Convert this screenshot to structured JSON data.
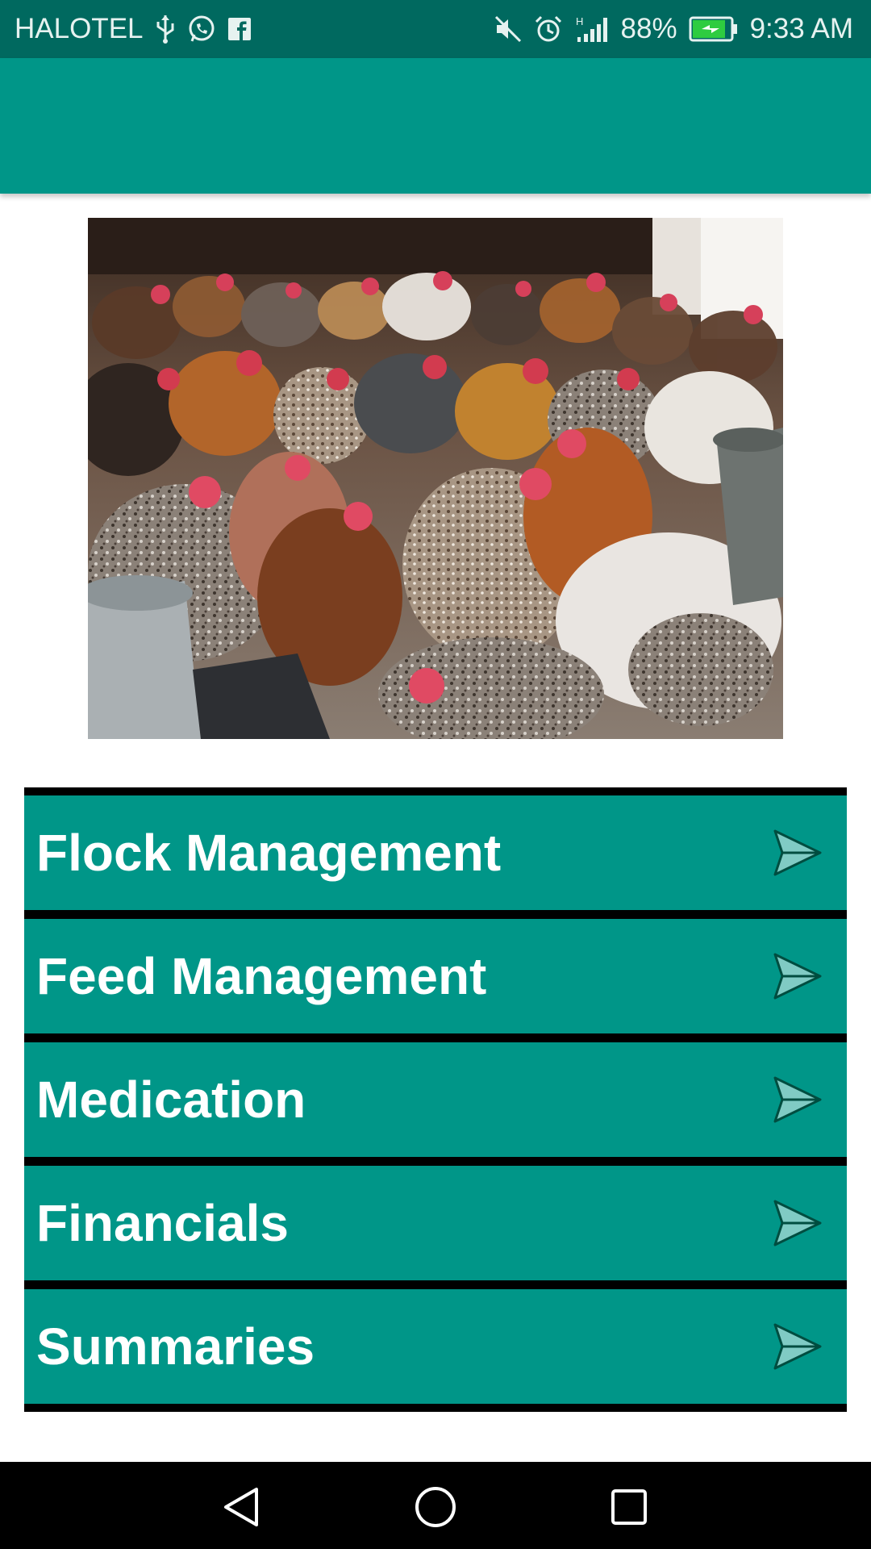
{
  "status_bar": {
    "carrier": "HALOTEL",
    "left_icons": [
      "usb-icon",
      "whatsapp-icon",
      "facebook-icon"
    ],
    "right_icons": [
      "mute-icon",
      "alarm-icon",
      "signal-icon",
      "battery-charging-icon"
    ],
    "network_type": "H",
    "battery_percent": "88%",
    "battery_level": 0.88,
    "time": "9:33 AM"
  },
  "app_bar": {
    "title": ""
  },
  "hero_image": {
    "subject": "chickens-photo"
  },
  "menu": {
    "items": [
      {
        "label": "Flock Management",
        "icon": "send-arrow-icon"
      },
      {
        "label": "Feed Management",
        "icon": "send-arrow-icon"
      },
      {
        "label": "Medication",
        "icon": "send-arrow-icon"
      },
      {
        "label": "Financials",
        "icon": "send-arrow-icon"
      },
      {
        "label": "Summaries",
        "icon": "send-arrow-icon"
      }
    ]
  },
  "nav_bar": {
    "buttons": [
      "back-icon",
      "home-icon",
      "recents-icon"
    ]
  },
  "colors": {
    "status_bar": "#00695f",
    "app_bar": "#009688",
    "menu_item": "#009688",
    "menu_divider": "#000000",
    "arrow_fill": "#80cbc4",
    "nav_bar": "#000000"
  }
}
